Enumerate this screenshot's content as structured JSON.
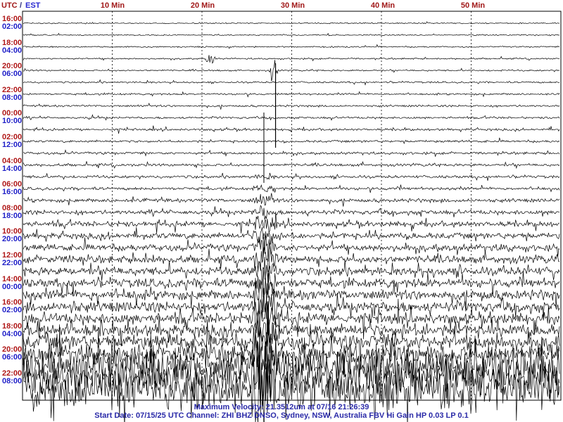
{
  "header": {
    "utc_label": "UTC",
    "separator": "/",
    "est_label": "EST"
  },
  "chart_data": {
    "type": "line",
    "title": "",
    "xlabel": "",
    "ylabel": "",
    "x_unit": "Min",
    "xlim": [
      0,
      60
    ],
    "minute_ticks": [
      "10 Min",
      "20 Min",
      "30 Min",
      "40 Min",
      "50 Min"
    ],
    "grid": true,
    "trace_minutes_per_row": 60,
    "traces_per_label_row": 2,
    "left_labels_utc": [
      "16:00",
      "18:00",
      "20:00",
      "22:00",
      "00:00",
      "02:00",
      "04:00",
      "06:00",
      "08:00",
      "10:00",
      "12:00",
      "14:00",
      "16:00",
      "18:00",
      "20:00",
      "22:00"
    ],
    "left_labels_est": [
      "02:00",
      "04:00",
      "06:00",
      "08:00",
      "10:00",
      "12:00",
      "14:00",
      "16:00",
      "18:00",
      "20:00",
      "22:00",
      "00:00",
      "02:00",
      "04:00",
      "06:00",
      "08:00"
    ],
    "trace_count": 32,
    "max_velocity": "21.3512um",
    "max_velocity_time": "07/16 21:26:39",
    "start_date": "07/15/25",
    "channel": "ZHI",
    "component": "BHZ",
    "station": "DNSO, Sydney, NSW, Australia",
    "instrument": "FBV Hi Gain HP 0.03  LP 0.1"
  },
  "footer": {
    "line1": "Maximum Velocity: 21.3512um at 07/16 21:26:39",
    "line2": "Start Date: 07/15/25 UTC Channel: ZHI  BHZ  DNSO, Sydney, NSW, Australia  FBV Hi Gain HP 0.03  LP 0.1"
  },
  "colors": {
    "trace": "#000000",
    "grid": "#000000",
    "utc_label": "#b01818",
    "est_label": "#2020c8",
    "footer_text": "#2a2aa8",
    "minute_label": "#a01818"
  }
}
